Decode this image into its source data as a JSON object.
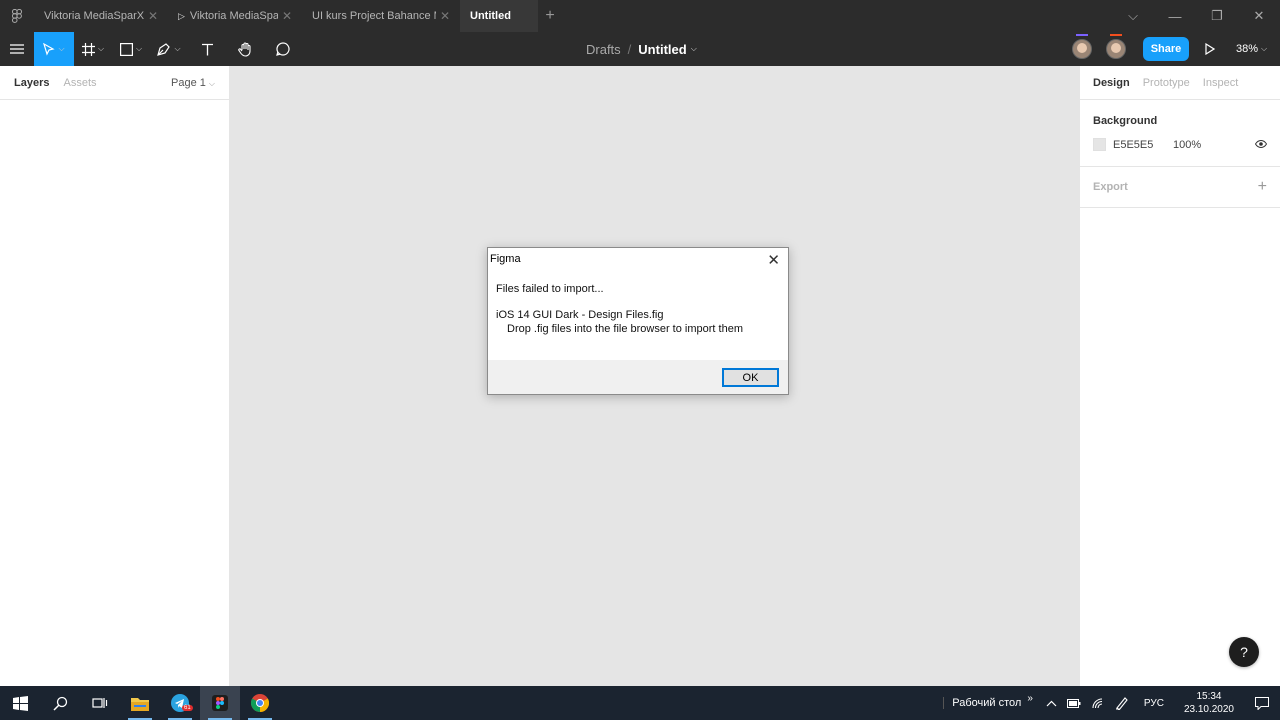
{
  "tabs": [
    {
      "label": "Viktoria MediaSparX",
      "play": false
    },
    {
      "label": "Viktoria MediaSparX",
      "play": true
    },
    {
      "label": "UI kurs Project Bahance MITkA",
      "play": false
    }
  ],
  "active_tab": "Untitled",
  "toolbar": {
    "breadcrumb_root": "Drafts",
    "breadcrumb_sep": "/",
    "file_title": "Untitled",
    "share_label": "Share",
    "zoom": "38%"
  },
  "left_panel": {
    "tabs": [
      "Layers",
      "Assets"
    ],
    "page_selector": "Page 1"
  },
  "right_panel": {
    "tabs": [
      "Design",
      "Prototype",
      "Inspect"
    ],
    "background_title": "Background",
    "background_hex": "E5E5E5",
    "background_opacity": "100%",
    "export_label": "Export"
  },
  "help_label": "?",
  "dialog": {
    "title": "Figma",
    "message": "Files failed to import...",
    "file": "iOS 14 GUI Dark - Design Files.fig",
    "hint": "Drop .fig files into the file browser to import them",
    "ok_label": "OK"
  },
  "taskbar": {
    "desktop_label": "Рабочий стол",
    "lang": "РУС",
    "time": "15:34",
    "date": "23.10.2020",
    "telegram_badge": "61"
  },
  "colors": {
    "accent": "#18a0fb",
    "chrome": "#2c2c2c",
    "canvas": "#e5e5e5",
    "avatar_mark_1": "#7b61ff",
    "avatar_mark_2": "#f24e1e"
  }
}
